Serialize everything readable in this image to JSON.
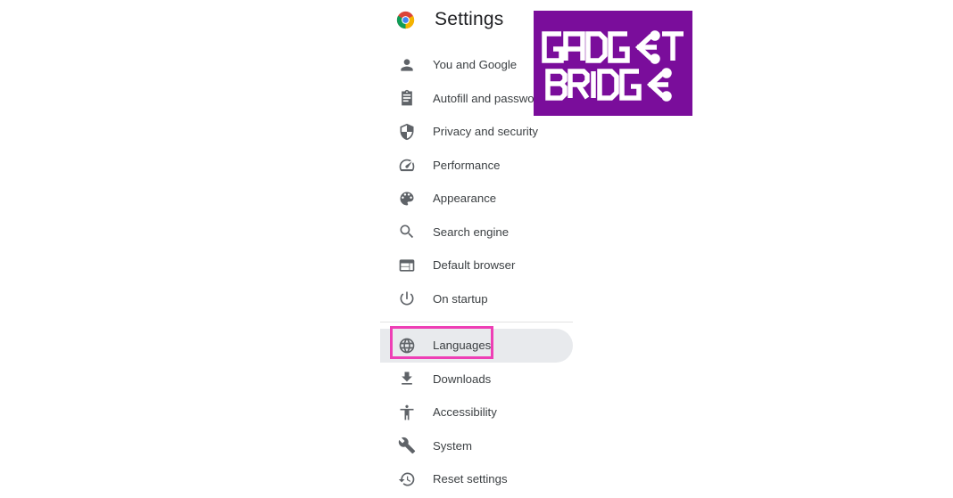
{
  "header": {
    "title": "Settings",
    "logo_icon": "chrome-icon"
  },
  "nav": {
    "items": [
      {
        "label": "You and Google",
        "icon": "person-icon"
      },
      {
        "label": "Autofill and passwords",
        "icon": "clipboard-icon"
      },
      {
        "label": "Privacy and security",
        "icon": "shield-icon"
      },
      {
        "label": "Performance",
        "icon": "gauge-icon"
      },
      {
        "label": "Appearance",
        "icon": "palette-icon"
      },
      {
        "label": "Search engine",
        "icon": "search-icon"
      },
      {
        "label": "Default browser",
        "icon": "browser-window-icon"
      },
      {
        "label": "On startup",
        "icon": "power-icon"
      },
      {
        "label": "Languages",
        "icon": "globe-icon",
        "selected": true
      },
      {
        "label": "Downloads",
        "icon": "download-icon"
      },
      {
        "label": "Accessibility",
        "icon": "accessibility-icon"
      },
      {
        "label": "System",
        "icon": "wrench-icon"
      },
      {
        "label": "Reset settings",
        "icon": "history-icon"
      }
    ]
  },
  "watermark": {
    "line1": "GADGET",
    "line2": "BRIDGE",
    "background": "#7a0d9b"
  },
  "colors": {
    "highlight": "#ee3fb5",
    "selected_bg": "#e8eaed",
    "icon": "#5f6368"
  }
}
